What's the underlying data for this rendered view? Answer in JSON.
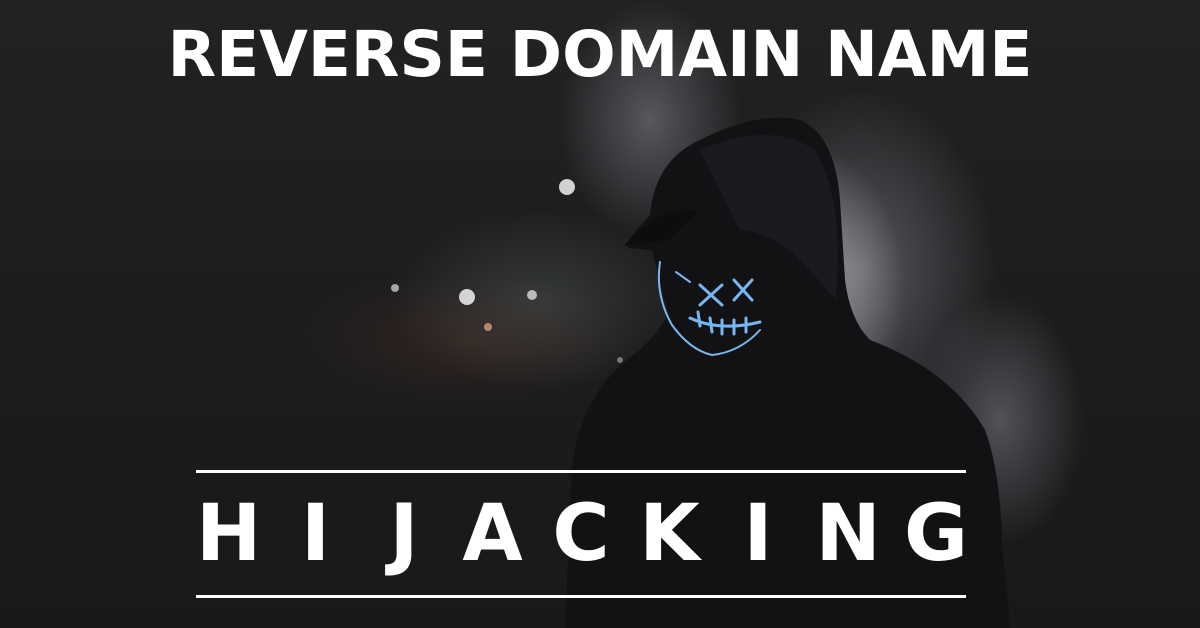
{
  "banner": {
    "headline_top": "REVERSE DOMAIN NAME",
    "headline_bottom": "HIJACKING",
    "image_subject": "hooded-figure-with-glowing-x-mask-in-smoke"
  },
  "colors": {
    "text": "#ffffff",
    "background": "#1c1c1e",
    "mask_glow": "#6fb6ff",
    "smoke": "#d8d8dc"
  }
}
